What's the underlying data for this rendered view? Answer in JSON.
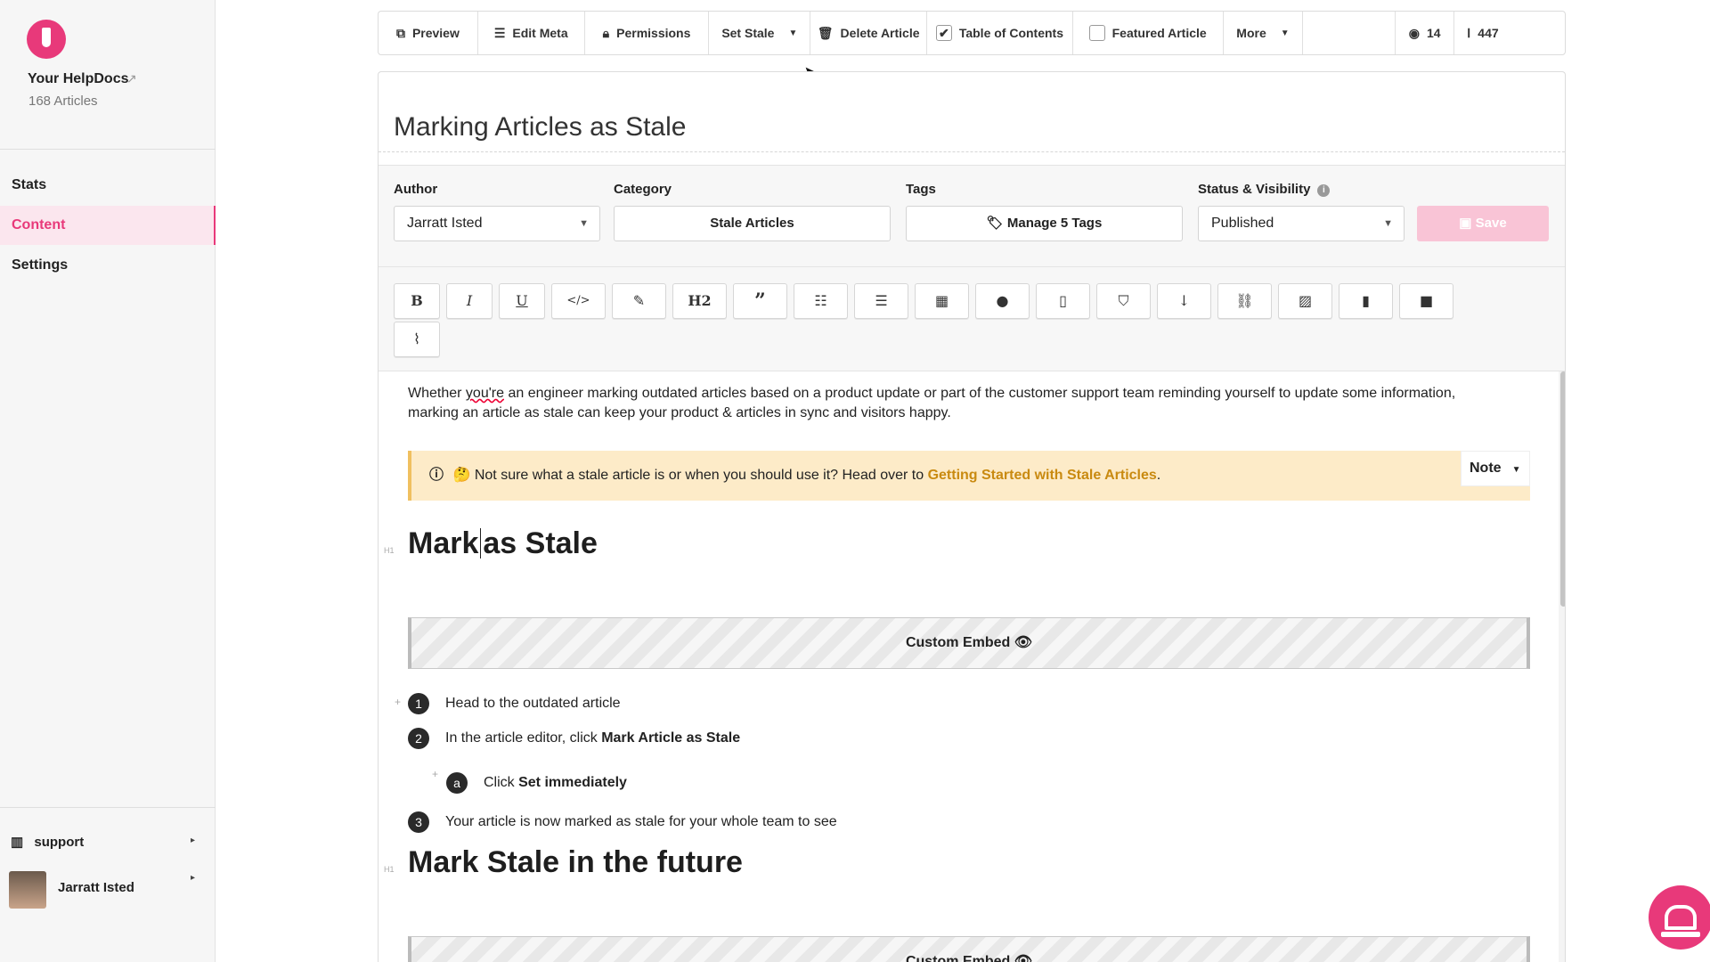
{
  "sidebar": {
    "brand_name": "Your HelpDocs",
    "article_count": "168 Articles",
    "nav": [
      {
        "label": "Stats"
      },
      {
        "label": "Content"
      },
      {
        "label": "Settings"
      }
    ],
    "workspace": "support",
    "user": "Jarratt Isted",
    "accent_color": "#e8397a"
  },
  "toolbar": {
    "preview": "Preview",
    "edit_meta": "Edit Meta",
    "permissions": "Permissions",
    "set_stale": "Set Stale",
    "delete_article": "Delete Article",
    "table_of_contents": "Table of Contents",
    "table_of_contents_checked": true,
    "featured_article": "Featured Article",
    "featured_checked": false,
    "more": "More",
    "views_count": "14",
    "word_count": "447"
  },
  "article": {
    "title": "Marking Articles as Stale",
    "author_label": "Author",
    "author_value": "Jarratt Isted",
    "category_label": "Category",
    "category_value": "Stale Articles",
    "tags_label": "Tags",
    "tags_value": "Manage 5 Tags",
    "status_label": "Status & Visibility",
    "status_value": "Published",
    "save_label": "Save"
  },
  "format_buttons": [
    "bold-icon",
    "italic-icon",
    "underline-icon",
    "code-icon",
    "brush-icon",
    "heading2-icon",
    "quote-icon",
    "ordered-list-icon",
    "bullet-list-icon",
    "table-icon",
    "comment-icon",
    "code-file-icon",
    "html5-icon",
    "arrow-down-icon",
    "link-icon",
    "image-icon",
    "file-icon",
    "video-icon",
    "paperclip-icon"
  ],
  "content": {
    "intro_a": "Whether ",
    "intro_spell": "you're",
    "intro_b": " an engineer marking outdated articles based on a product update or part of the customer support team reminding yourself to update some information,",
    "intro_c": "marking an article as stale can keep your product & articles in sync and visitors happy.",
    "note_emoji": "🤔",
    "note_text": "Not sure what a stale article is or when you should use it? Head over to",
    "note_link": "Getting Started with Stale Articles",
    "note_period": ".",
    "note_type": "Note",
    "h1_tag": "H1",
    "heading1_a": "Mark",
    "heading1_b": "as Stale",
    "embed_label": "Custom Embed",
    "steps": [
      {
        "num": "1",
        "text": "Head to the outdated article",
        "bold": ""
      },
      {
        "num": "2",
        "text": "In the article editor, click ",
        "bold": "Mark Article as Stale"
      },
      {
        "num": "a",
        "text": "Click ",
        "bold": "Set immediately"
      },
      {
        "num": "3",
        "text": "Your article is now marked as stale for your whole team to see",
        "bold": ""
      }
    ],
    "heading2": "Mark Stale in the future",
    "embed2_label": "Custom Embed"
  }
}
